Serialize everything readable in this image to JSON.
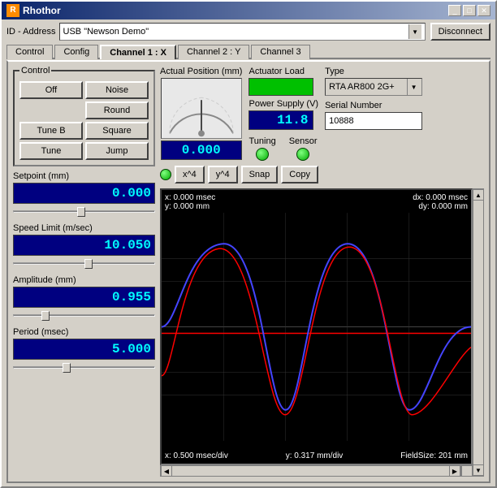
{
  "window": {
    "title": "Rhothor",
    "icon": "R"
  },
  "title_buttons": {
    "minimize": "_",
    "maximize": "□",
    "close": "✕"
  },
  "top_bar": {
    "id_label": "ID - Address",
    "id_value": "USB \"Newson Demo\"",
    "disconnect_label": "Disconnect"
  },
  "tabs": [
    {
      "label": "Control",
      "active": false
    },
    {
      "label": "Config",
      "active": false
    },
    {
      "label": "Channel 1 : X",
      "active": true
    },
    {
      "label": "Channel 2 : Y",
      "active": false
    },
    {
      "label": "Channel 3",
      "active": false
    }
  ],
  "control_group": {
    "label": "Control",
    "buttons": [
      {
        "label": "Off",
        "col": 1
      },
      {
        "label": "Noise",
        "col": 2
      },
      {
        "label": "Round",
        "col": 2
      },
      {
        "label": "Tune B",
        "col": 1
      },
      {
        "label": "Square",
        "col": 2
      },
      {
        "label": "Tune",
        "col": 1
      },
      {
        "label": "Jump",
        "col": 2
      }
    ]
  },
  "setpoint": {
    "label": "Setpoint (mm)",
    "value": "0.000"
  },
  "speed_limit": {
    "label": "Speed Limit (m/sec)",
    "value": "10.050"
  },
  "amplitude": {
    "label": "Amplitude (mm)",
    "value": "0.955"
  },
  "period": {
    "label": "Period (msec)",
    "value": "5.000"
  },
  "actual_position": {
    "label": "Actual Position (mm)",
    "value": "0.000"
  },
  "actuator_load": {
    "label": "Actuator Load"
  },
  "power_supply": {
    "label": "Power Supply (V)",
    "value": "11.8"
  },
  "type": {
    "label": "Type",
    "value": "RTA AR800 2G+"
  },
  "serial_number": {
    "label": "Serial Number",
    "value": "10888"
  },
  "tuning": {
    "label": "Tuning"
  },
  "sensor": {
    "label": "Sensor"
  },
  "chart_controls": {
    "x4_label": "x^4",
    "y4_label": "y^4",
    "snap_label": "Snap",
    "copy_label": "Copy"
  },
  "chart": {
    "top_left_x": "x: 0.000 msec",
    "top_left_y": "y: 0.000 mm",
    "top_right_dx": "dx: 0.000 msec",
    "top_right_dy": "dy: 0.000 mm",
    "bottom_left": "x: 0.500 msec/div",
    "bottom_middle": "y: 0.317 mm/div",
    "bottom_right": "FieldSize: 201 mm"
  }
}
